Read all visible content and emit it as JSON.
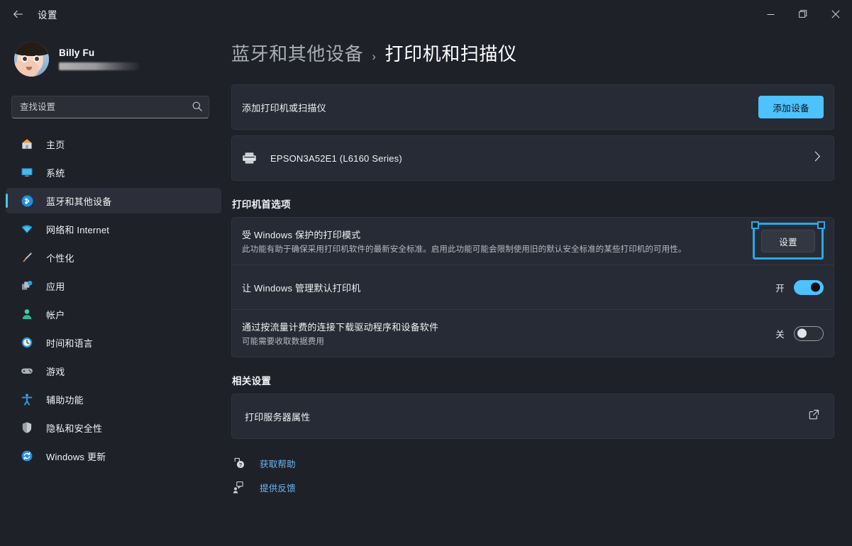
{
  "window": {
    "title": "设置",
    "back_icon": "back-arrow-icon",
    "minimize_label": "最小化",
    "maximize_label": "最大化",
    "close_label": "关闭"
  },
  "sidebar": {
    "profile": {
      "name": "Billy Fu",
      "email_redacted": true
    },
    "search": {
      "placeholder": "查找设置",
      "value": ""
    },
    "items": [
      {
        "label": "主页",
        "icon": "home-icon",
        "selected": false
      },
      {
        "label": "系统",
        "icon": "system-icon",
        "selected": false
      },
      {
        "label": "蓝牙和其他设备",
        "icon": "bluetooth-icon",
        "selected": true
      },
      {
        "label": "网络和 Internet",
        "icon": "network-icon",
        "selected": false
      },
      {
        "label": "个性化",
        "icon": "personalization-brush-icon",
        "selected": false
      },
      {
        "label": "应用",
        "icon": "apps-icon",
        "selected": false
      },
      {
        "label": "帐户",
        "icon": "accounts-person-icon",
        "selected": false
      },
      {
        "label": "时间和语言",
        "icon": "clock-icon",
        "selected": false
      },
      {
        "label": "游戏",
        "icon": "gaming-controller-icon",
        "selected": false
      },
      {
        "label": "辅助功能",
        "icon": "accessibility-icon",
        "selected": false
      },
      {
        "label": "隐私和安全性",
        "icon": "shield-icon",
        "selected": false
      },
      {
        "label": "Windows 更新",
        "icon": "update-refresh-icon",
        "selected": false
      }
    ]
  },
  "main": {
    "breadcrumb": {
      "parent": "蓝牙和其他设备",
      "separator": "›",
      "current": "打印机和扫描仪"
    },
    "add_card": {
      "label": "添加打印机或扫描仪",
      "button": "添加设备"
    },
    "printers": [
      {
        "name": "EPSON3A52E1 (L6160 Series)",
        "icon": "printer-icon",
        "chevron": "chevron-right-icon"
      }
    ],
    "preferences_heading": "打印机首选项",
    "protected_print": {
      "title": "受 Windows 保护的打印模式",
      "description": "此功能有助于确保采用打印机软件的最新安全标准。启用此功能可能会限制使用旧的默认安全标准的某些打印机的可用性。",
      "button": "设置",
      "focused": true,
      "focus_color": "#2aa8e8"
    },
    "manage_default": {
      "title": "让 Windows 管理默认打印机",
      "state_label": "开",
      "state_on": true
    },
    "metered_download": {
      "title": "通过按流量计费的连接下载驱动程序和设备软件",
      "description": "可能需要收取数据费用",
      "state_label": "关",
      "state_on": false
    },
    "related_heading": "相关设置",
    "related_items": [
      {
        "label": "打印服务器属性",
        "icon": "external-link-icon"
      }
    ],
    "help_links": [
      {
        "label": "获取帮助",
        "icon": "help-question-icon"
      },
      {
        "label": "提供反馈",
        "icon": "feedback-icon"
      }
    ]
  },
  "theme": {
    "accent": "#4cc2ff",
    "page_bg": "#1f2129",
    "card_bg": "#272b35",
    "link": "#6cb8f2",
    "focus": "#2aa8e8"
  }
}
